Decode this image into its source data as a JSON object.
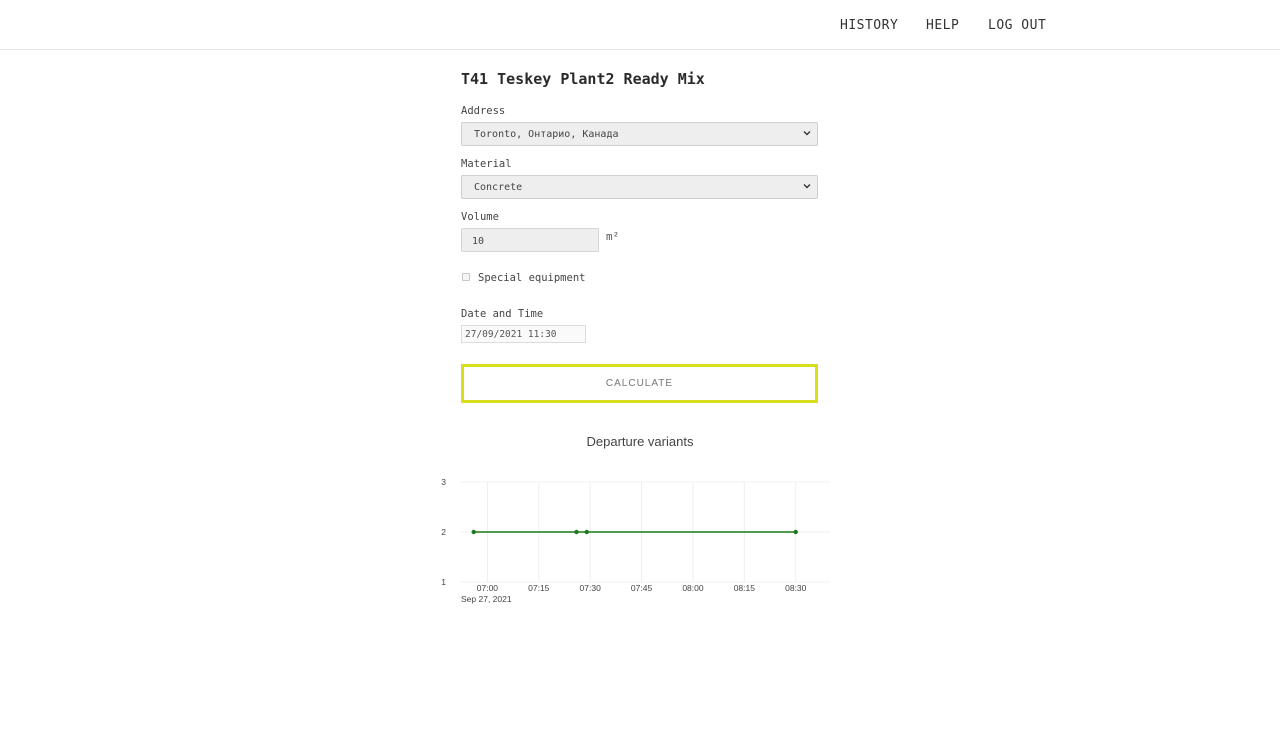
{
  "nav": {
    "history": "HISTORY",
    "help": "HELP",
    "logout": "LOG OUT"
  },
  "form": {
    "title": "T41 Teskey Plant2 Ready Mix",
    "address_label": "Address",
    "address_value": "Toronto, Онтарио, Канада",
    "material_label": "Material",
    "material_value": "Concrete",
    "volume_label": "Volume",
    "volume_value": "10",
    "volume_unit": "m²",
    "special_equipment_label": "Special equipment",
    "special_equipment_checked": false,
    "datetime_label": "Date and Time",
    "datetime_value": "27/09/2021 11:30",
    "calculate_label": "CALCULATE"
  },
  "colors": {
    "accent": "#d8de1c",
    "line": "#1a7a1a"
  },
  "chart_data": {
    "type": "line",
    "title": "Departure variants",
    "xlabel": "",
    "ylabel": "",
    "xlim": [
      "06:52",
      "08:40"
    ],
    "ylim": [
      1,
      3
    ],
    "x_ticks": [
      "07:00",
      "07:15",
      "07:30",
      "07:45",
      "08:00",
      "08:15",
      "08:30"
    ],
    "x_date_label": "Sep 27, 2021",
    "y_ticks": [
      1,
      2,
      3
    ],
    "grid": true,
    "series": [
      {
        "x": [
          "06:56",
          "07:26",
          "07:29",
          "08:30"
        ],
        "y": [
          2,
          2,
          2,
          2
        ]
      }
    ]
  }
}
